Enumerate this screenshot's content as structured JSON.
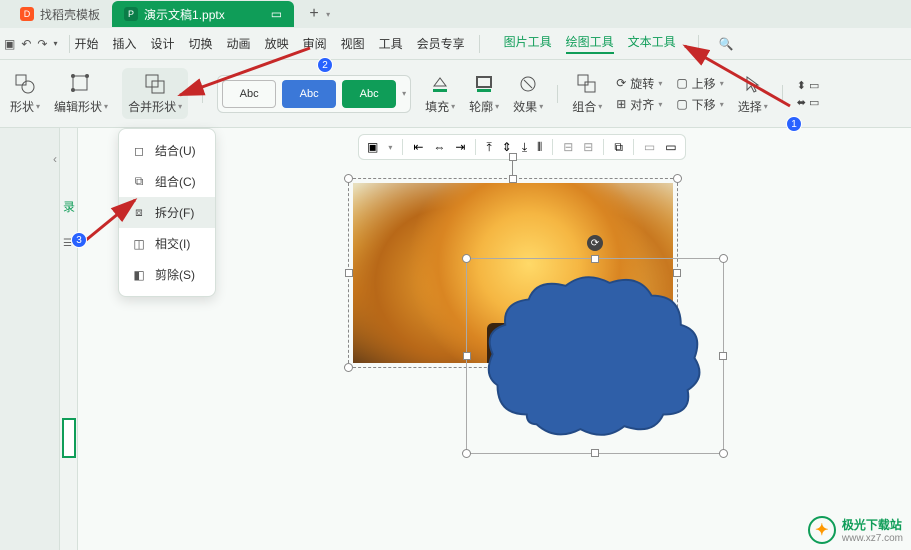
{
  "tabs": {
    "inactive": "找稻壳模板",
    "active": "演示文稿1.pptx",
    "newtab": "+"
  },
  "menu": {
    "items": [
      "开始",
      "插入",
      "设计",
      "切换",
      "动画",
      "放映",
      "审阅",
      "视图",
      "工具",
      "会员专享"
    ],
    "tools": [
      "图片工具",
      "绘图工具",
      "文本工具"
    ]
  },
  "ribbon": {
    "shape": "形状",
    "editshape": "编辑形状",
    "merge": "合并形状",
    "abc": "Abc",
    "fill": "填充",
    "outline": "轮廓",
    "effect": "效果",
    "group": "组合",
    "rotate": "旋转",
    "align": "对齐",
    "up": "上移",
    "down": "下移",
    "select": "选择"
  },
  "dropdown": {
    "items": [
      {
        "label": "结合(U)"
      },
      {
        "label": "组合(C)"
      },
      {
        "label": "拆分(F)"
      },
      {
        "label": "相交(I)"
      },
      {
        "label": "剪除(S)"
      }
    ],
    "hoverIndex": 2
  },
  "outline_label": "录",
  "badges": {
    "b1": "1",
    "b2": "2",
    "b3": "3"
  },
  "watermark": {
    "brand": "极光下载站",
    "url": "www.xz7.com"
  }
}
